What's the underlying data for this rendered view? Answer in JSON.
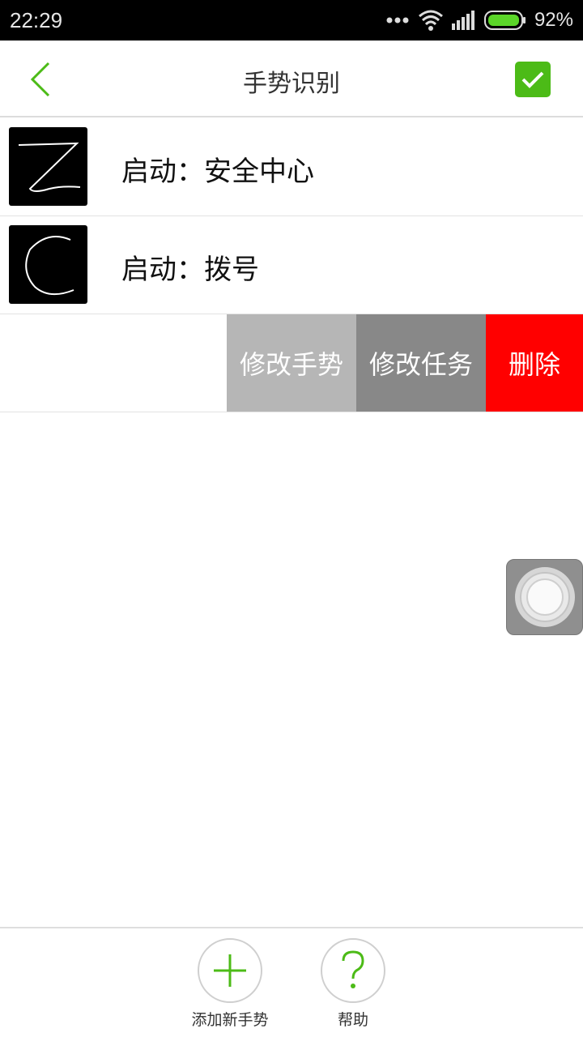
{
  "status_bar": {
    "time": "22:29",
    "battery_percent": "92%",
    "icons": [
      "more-dots-icon",
      "wifi-icon",
      "signal-icon",
      "battery-icon"
    ]
  },
  "header": {
    "title": "手势识别",
    "back_icon": "chevron-left-icon",
    "confirm_icon": "check-icon",
    "accent": "#4cbb17"
  },
  "gestures": [
    {
      "label": "启动：安全中心",
      "shape": "Z"
    },
    {
      "label": "启动：拨号",
      "shape": "C"
    }
  ],
  "swipe_actions": [
    {
      "label": "修改手势",
      "color": "#b6b6b6"
    },
    {
      "label": "修改任务",
      "color": "#888888"
    },
    {
      "label": "删除",
      "color": "#ff0000"
    }
  ],
  "bottom_bar": {
    "add_label": "添加新手势",
    "help_label": "帮助",
    "add_icon": "plus-icon",
    "help_icon": "question-icon"
  }
}
